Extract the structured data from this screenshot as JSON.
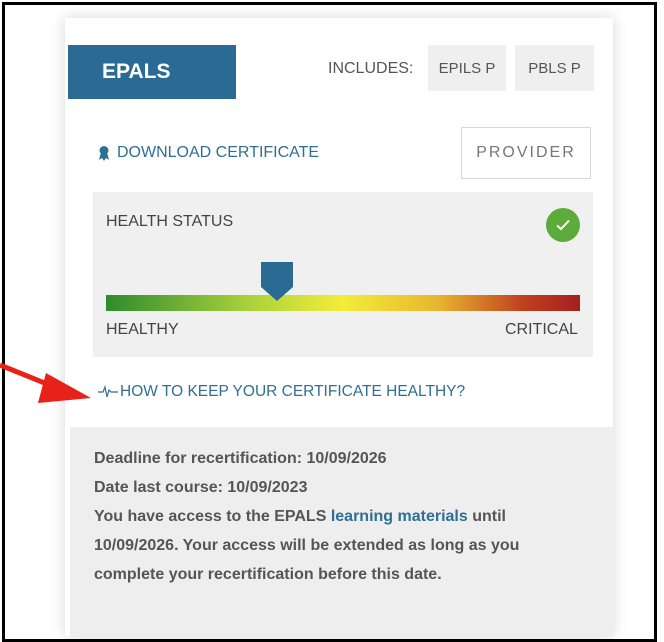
{
  "card": {
    "course": "EPALS",
    "includes_label": "INCLUDES:",
    "includes": [
      "EPILS P",
      "PBLS P"
    ],
    "download_label": "DOWNLOAD CERTIFICATE",
    "role_button": "PROVIDER"
  },
  "health": {
    "title": "HEALTH STATUS",
    "status_icon": "check-circle-icon",
    "status_color": "#5cab3b",
    "level": 0.36,
    "low_label": "HEALTHY",
    "high_label": "CRITICAL",
    "gradient": [
      "#2e8b2e",
      "#a8d23a",
      "#f4ec3a",
      "#e8b62e",
      "#c04020",
      "#a32020"
    ]
  },
  "keep_link": "HOW TO KEEP YOUR CERTIFICATE HEALTHY?",
  "info": {
    "deadline": "Deadline for recertification: 10/09/2026",
    "last_course": "Date last course: 10/09/2023",
    "access_prefix": "You have access to the EPALS ",
    "access_link": "learning materials",
    "access_suffix": " until 10/09/2026. Your access will be extended as long as you complete your recertification before this date."
  },
  "colors": {
    "brand": "#2b6a93",
    "link": "#2f6f93",
    "arrow": "#e8221a"
  }
}
